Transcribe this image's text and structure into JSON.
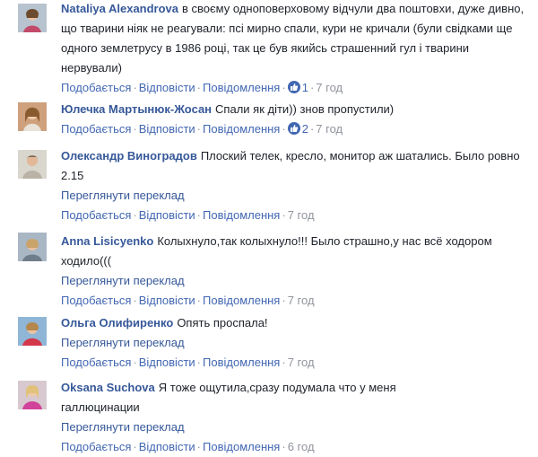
{
  "labels": {
    "like": "Подобається",
    "reply": "Відповісти",
    "message": "Повідомлення",
    "translate": "Переглянути переклад",
    "separator": "·"
  },
  "comments": [
    {
      "author": "Nataliya Alexandrova",
      "text": "в своєму одноповерховому відчули два поштовхи, дуже дивно, що тварини ніяк не реагували: псі мирно спали, кури не кричали (були свідками ще одного землетрусу в 1986 році, так це був якийсь страшенний гул і тварини нервували)",
      "likes": "1",
      "time": "7 год"
    },
    {
      "author": "Юлечка Мартынюк-Жосан",
      "text": "Спали як діти)) знов пропустили)",
      "likes": "2",
      "time": "7 год"
    },
    {
      "author": "Олександр Виноградов",
      "text": "Плоский телек, кресло, монитор аж шатались. Было ровно 2.15",
      "time": "7 год"
    },
    {
      "author": "Anna Lisicyenko",
      "text": "Колыхнуло,так колыхнуло!!! Было страшно,у нас всё ходором ходило(((",
      "time": "7 год"
    },
    {
      "author": "Ольга Олифиренко",
      "text": "Опять проспала!",
      "time": "7 год"
    },
    {
      "author": "Oksana Suchova",
      "text": "Я тоже ощутила,сразу подумала что у меня галлюцинации",
      "time": "6 год"
    }
  ]
}
